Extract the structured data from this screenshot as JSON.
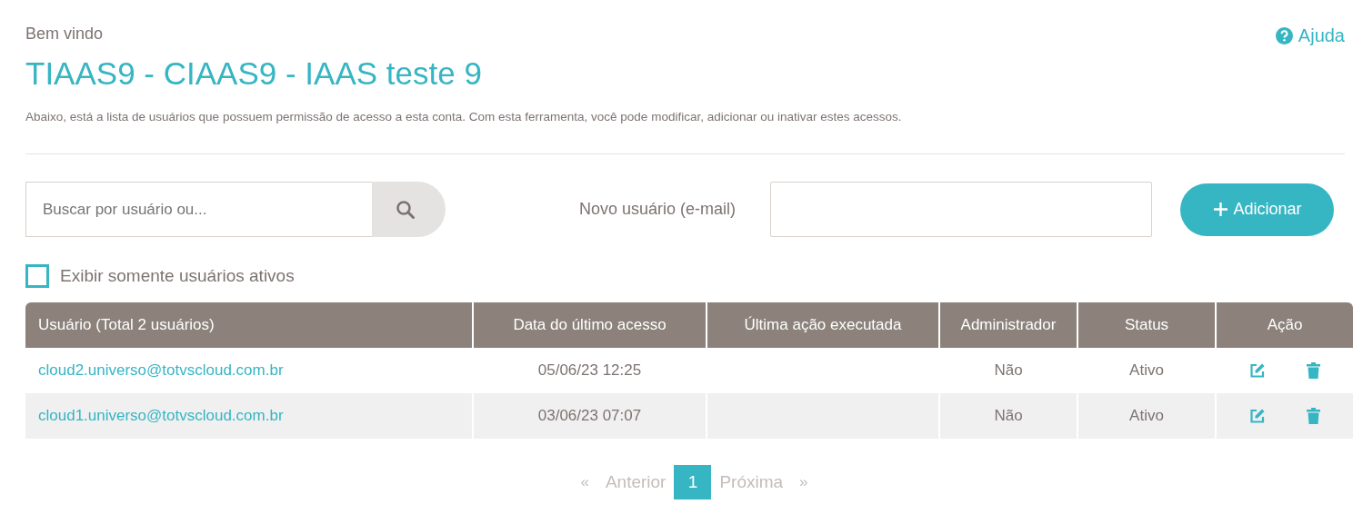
{
  "header": {
    "greeting": "Bem vindo",
    "title": "TIAAS9 - CIAAS9 - IAAS teste 9",
    "help": "Ajuda",
    "description": "Abaixo, está a lista de usuários que possuem permissão de acesso a esta conta. Com esta ferramenta, você pode modificar, adicionar ou inativar estes acessos."
  },
  "search": {
    "placeholder": "Buscar por usuário ou..."
  },
  "new_user": {
    "label": "Novo usuário (e-mail)",
    "button": "Adicionar"
  },
  "filter": {
    "label": "Exibir somente usuários ativos",
    "checked": false
  },
  "table": {
    "columns": [
      "Usuário (Total 2 usuários)",
      "Data do último acesso",
      "Última ação executada",
      "Administrador",
      "Status",
      "Ação"
    ],
    "rows": [
      {
        "user": "cloud2.universo@totvscloud.com.br",
        "last_access": "05/06/23 12:25",
        "admin": "Não",
        "status": "Ativo"
      },
      {
        "user": "cloud1.universo@totvscloud.com.br",
        "last_access": "03/06/23 07:07",
        "admin": "Não",
        "status": "Ativo"
      }
    ]
  },
  "pagination": {
    "first": {
      "label": "«",
      "disabled": true
    },
    "prev": {
      "label": "Anterior",
      "disabled": true
    },
    "pages": [
      {
        "label": "1",
        "selected": true
      }
    ],
    "next": {
      "label": "Próxima",
      "disabled": true
    },
    "last": {
      "label": "»",
      "disabled": true
    }
  }
}
